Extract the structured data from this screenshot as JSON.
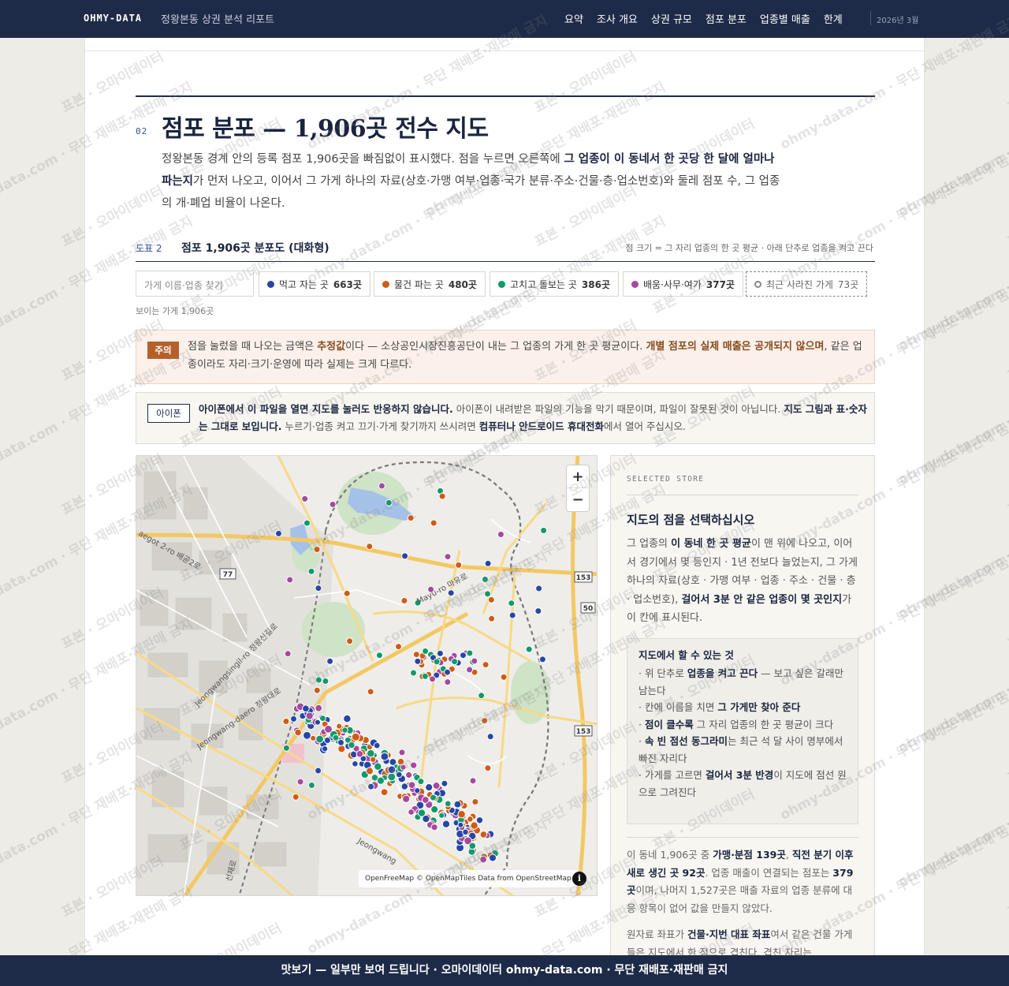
{
  "header": {
    "brand": "OHMY-DATA",
    "subtitle": "정왕본동 상권 분석 리포트",
    "nav": [
      "요약",
      "조사 개요",
      "상권 규모",
      "점포 분포",
      "업종별 매출",
      "한계"
    ],
    "date": "2026년 3월"
  },
  "section": {
    "number": "02",
    "title": "점포 분포 — 1,906곳 전수 지도",
    "intro_1": "정왕본동 경계 안의 등록 점포 1,906곳을 빠짐없이 표시했다. 점을 누르면 오른쪽에 ",
    "intro_bold": "그 업종이 이 동네서 한 곳당 한 달에 얼마나 파는지",
    "intro_2": "가 먼저 나오고, 이어서 그 가게 하나의 자료(상호·가맹 여부·업종·국가 분류·주소·건물·층·업소번호)와 둘레 점포 수, 그 업종의 개·폐업 비율이 나온다."
  },
  "figure": {
    "label": "도표 2",
    "title": "점포 1,906곳 분포도 (대화형)",
    "note": "점 크기 = 그 자리 업종의 한 곳 평균 · 아래 단추로 업종을 켜고 끈다"
  },
  "filters": {
    "search_placeholder": "가게 이름·업종 찾기",
    "chips": [
      {
        "label": "먹고 자는 곳",
        "count": "663곳",
        "color": "#2746a6"
      },
      {
        "label": "물건 파는 곳",
        "count": "480곳",
        "color": "#cf5c14"
      },
      {
        "label": "고치고 돌보는 곳",
        "count": "386곳",
        "color": "#0f9a6a"
      },
      {
        "label": "배움·사무·여가",
        "count": "377곳",
        "color": "#a44a9e"
      },
      {
        "label": "최근 사라진 가게",
        "count": "73곳",
        "color": "#888888"
      }
    ],
    "visible_count": "보이는 가게 1,906곳"
  },
  "notice": {
    "tag": "주의",
    "t1": "점을 눌렀을 때 나오는 금액은 ",
    "b1": "추정값",
    "t2": "이다 — 소상공인시장진흥공단이 내는 그 업종의 가게 한 곳 평균이다. ",
    "b2": "개별 점포의 실제 매출은 공개되지 않으며",
    "t3": ", 같은 업종이라도 자리·크기·운영에 따라 실제는 크게 다르다."
  },
  "ios": {
    "tag": "아이폰",
    "b1": "아이폰에서 이 파일을 열면 지도를 눌러도 반응하지 않습니다.",
    "t1": " 아이폰이 내려받은 파일의 기능을 막기 때문이며, 파일이 잘못된 것이 아닙니다. ",
    "b2": "지도 그림과 표·숫자는 그대로 보입니다.",
    "t2": " 누르기·업종 켜고 끄기·가게 찾기까지 쓰시려면 ",
    "b3": "컴퓨터나 안드로이드 휴대전화",
    "t3": "에서 열어 주십시오."
  },
  "map": {
    "zoom_in": "+",
    "zoom_out": "−",
    "attribution": "OpenFreeMap © OpenMapTiles Data from OpenStreetMap",
    "info": "i",
    "road_labels": [
      "Mayu-ro 마유로",
      "Jeongwangsingil-ro 정왕신길로",
      "Jeongwang-daero 정왕대로",
      "aegot 2-ro 배곧2로",
      "Jeongwang",
      "선재로",
      "77",
      "153",
      "50",
      "153"
    ]
  },
  "panel": {
    "eyebrow": "SELECTED STORE",
    "title": "지도의 점을 선택하십시오",
    "d1": "그 업종의 ",
    "d1b": "이 동네 한 곳 평균",
    "d2": "이 맨 위에 나오고, 이어서 경기에서 몇 등인지 · 1년 전보다 늘었는지, 그 가게 하나의 자료(상호 · 가맹 여부 · 업종 · 주소 · 건물 · 층 · 업소번호), ",
    "d2b": "걸어서 3분 안 같은 업종이 몇 곳인지",
    "d3": "가 이 칸에 표시된다.",
    "howto_title": "지도에서 할 수 있는 것",
    "h1a": "· 위 단추로 ",
    "h1b": "업종을 켜고 끈다",
    "h1c": " — 보고 싶은 갈래만 남는다",
    "h2a": "· 칸에 이름을 치면 ",
    "h2b": "그 가게만 찾아 준다",
    "h3a": "· ",
    "h3b": "점이 클수록",
    "h3c": " 그 자리 업종의 한 곳 평균이 크다",
    "h4a": "· ",
    "h4b": "속 빈 점선 동그라미",
    "h4c": "는 최근 석 달 사이 명부에서 빠진 자리다",
    "h5a": "· 가게를 고르면 ",
    "h5b": "걸어서 3분 반경",
    "h5c": "이 지도에 점선 원으로 그려진다",
    "s1": "이 동네 1,906곳 중 ",
    "s1b": "가맹·분점 139곳",
    "s2": ", ",
    "s2b": "직전 분기 이후 새로 생긴 곳 92곳",
    "s3": ". 업종 매출이 연결되는 점포는 ",
    "s3b": "379곳",
    "s4": "이며, 나머지 1,527곳은 매출 자료의 업종 분류에 대응 항목이 없어 값을 만들지 않았다.",
    "n1": "원자료 좌표가 ",
    "n1b": "건물·지번 대표 좌표",
    "n2": "여서 같은 건물 가게들은 지도에서 한 점으로 겹친다. 겹친 자리는"
  },
  "watermark": [
    "표본 · 오마이데이터",
    "ohmy-data.com · 무단 재배포·재판매 금지"
  ],
  "footer": "맛보기 — 일부만 보여 드립니다 · 오마이데이터 ohmy-data.com · 무단 재배포·재판매 금지"
}
